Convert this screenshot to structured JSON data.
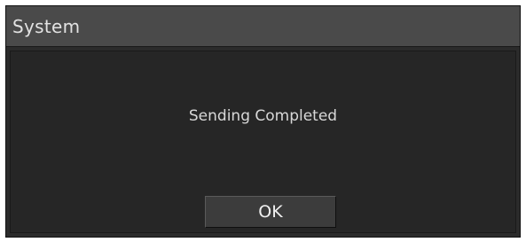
{
  "dialog": {
    "title": "System",
    "message": "Sending Completed",
    "ok_label": "OK"
  }
}
